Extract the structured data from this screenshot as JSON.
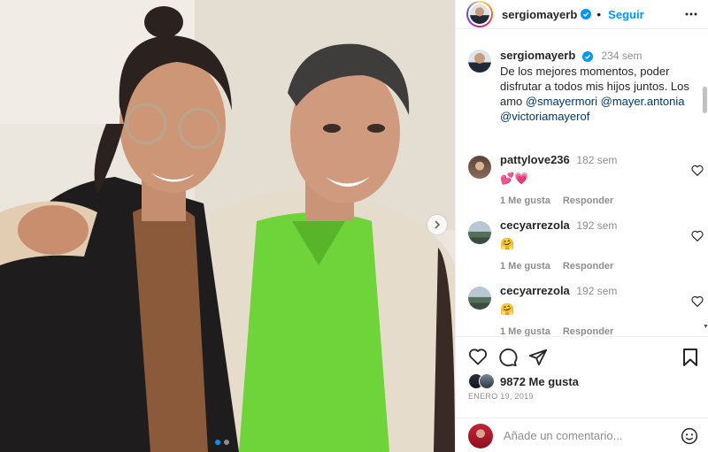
{
  "post": {
    "username": "sergiomayerb",
    "follow_label": "Seguir",
    "separator": "•",
    "caption_time": "234 sem",
    "caption_text": "De los mejores momentos, poder disfrutar a todos mis hijos juntos. Los amo",
    "mentions": [
      "@smayermori",
      "@mayer.antonia",
      "@victoriamayerof"
    ]
  },
  "comments": [
    {
      "user": "pattylove236",
      "time": "182 sem",
      "text": "💕💗",
      "likes": "1 Me gusta",
      "reply": "Responder"
    },
    {
      "user": "cecyarrezola",
      "time": "192 sem",
      "text": "🤗",
      "likes": "1 Me gusta",
      "reply": "Responder"
    },
    {
      "user": "cecyarrezola",
      "time": "192 sem",
      "text": "🤗",
      "likes": "1 Me gusta",
      "reply": "Responder"
    }
  ],
  "stats": {
    "likes": "9872 Me gusta",
    "date": "ENERO 19, 2019"
  },
  "comment_box": {
    "placeholder": "Añade un comentario..."
  },
  "colors": {
    "accent": "#0095f6",
    "verified": "#0095f6",
    "mention": "#00376b",
    "muted": "#8e8e8e"
  },
  "icons": [
    "more-icon",
    "verified-icon",
    "heart-icon",
    "comment-icon",
    "share-icon",
    "bookmark-icon",
    "emoji-icon",
    "chevron-right-icon"
  ]
}
